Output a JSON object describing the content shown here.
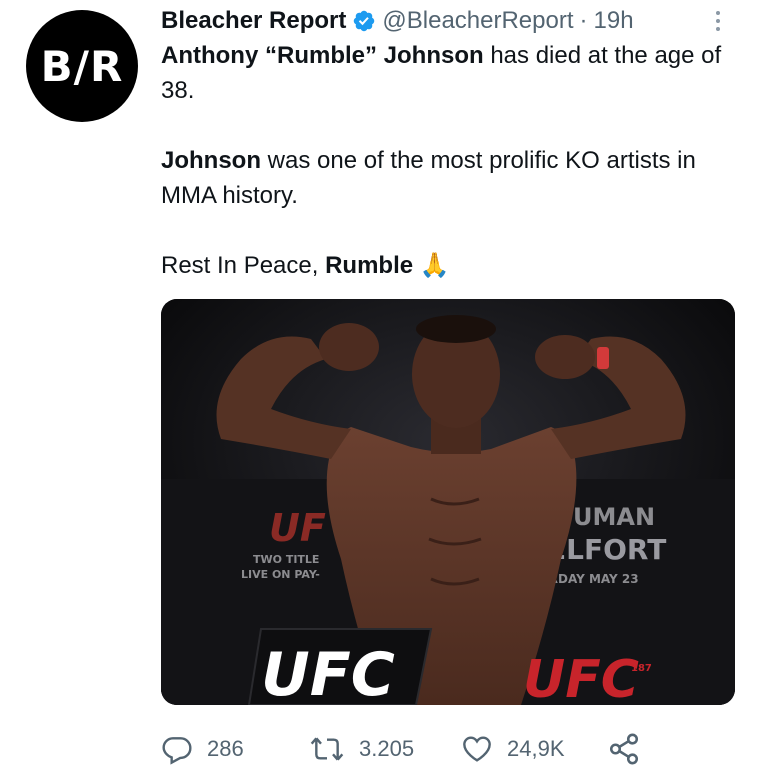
{
  "author": {
    "avatar_text": "B/R",
    "name": "Bleacher Report",
    "handle": "@BleacherReport",
    "separator": "·",
    "time": "19h"
  },
  "tweet": {
    "line1": {
      "bold": "Anthony “Rumble” Johnson",
      "text": " has died at the age of 38."
    },
    "line2": {
      "bold": "Johnson",
      "text": " was one of the most prolific KO artists in MMA history."
    },
    "line3": {
      "text": "Rest In Peace, ",
      "bold": "Rumble",
      "emoji": "🙏"
    }
  },
  "media": {
    "description": "fighter flexing at weigh-in",
    "banner_lines": [
      "UF",
      "TWO TITLE",
      "LIVE ON PAY-",
      "UMAN",
      "ELFORT",
      "URDAY MAY 23"
    ],
    "podium_logo": "UFC",
    "right_logo": "UFC",
    "right_logo_number": "187"
  },
  "actions": {
    "replies": "286",
    "retweets": "3.205",
    "likes": "24,9K"
  },
  "colors": {
    "text": "#0f1419",
    "muted": "#536471",
    "verified": "#1d9bf0",
    "ufc_red": "#c8242b"
  },
  "icons": [
    "verified-badge-icon",
    "more-icon",
    "reply-icon",
    "retweet-icon",
    "like-icon",
    "share-icon"
  ]
}
